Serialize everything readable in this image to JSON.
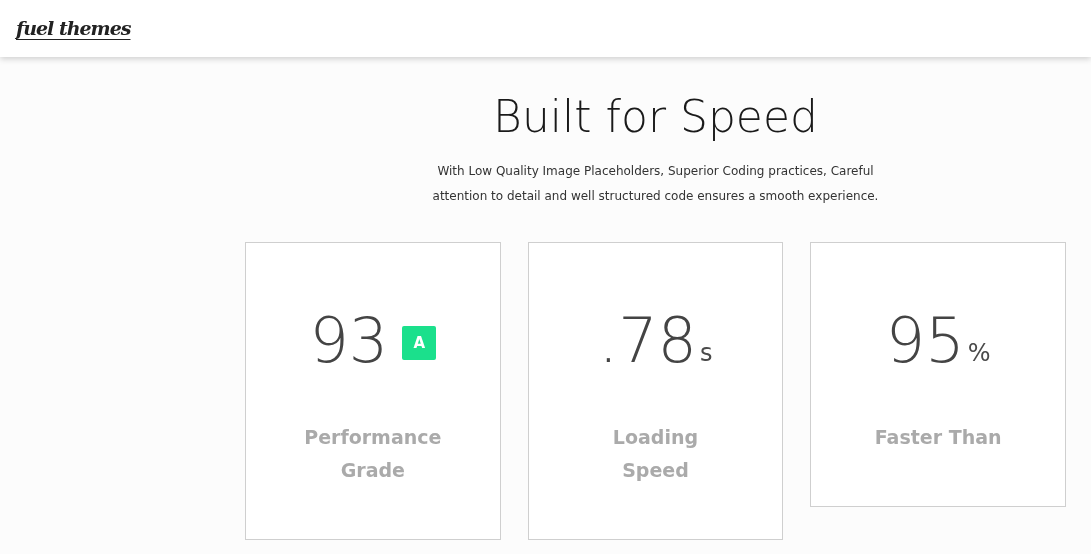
{
  "header": {
    "logo": "fuel themes"
  },
  "title": "Built for Speed",
  "intro": "With Low Quality Image Placeholders, Superior Coding practices, Careful attention to detail and well structured code ensures a smooth experience.",
  "stats": [
    {
      "value": "93",
      "suffix": "A",
      "kind": "badge",
      "label": "Performance Grade"
    },
    {
      "value": ".78",
      "suffix": "s",
      "kind": "unit",
      "label": "Loading Speed"
    },
    {
      "value": "95",
      "suffix": "%",
      "kind": "unit",
      "label": "Faster Than"
    }
  ]
}
